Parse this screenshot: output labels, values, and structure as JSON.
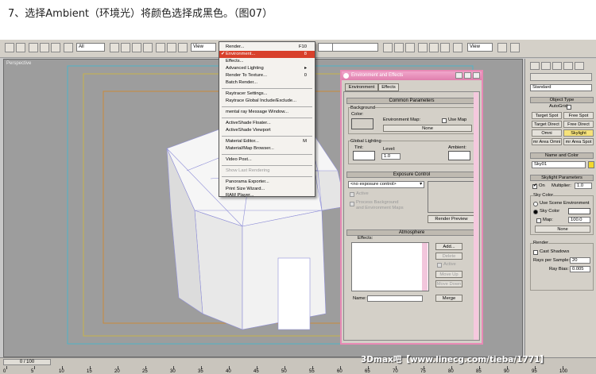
{
  "caption": "7、选择Ambient（环境光）将颜色选择成黑色。（图07）",
  "toolbar": {
    "select_filter": "All",
    "ref_coord": "View",
    "view_dropdown": "View"
  },
  "viewport": {
    "label": "Perspective"
  },
  "rendering_menu": {
    "items": [
      {
        "label": "Render...",
        "shortcut": "F10"
      },
      {
        "label": "Environment...",
        "shortcut": "8",
        "highlighted": true,
        "checked": true
      },
      {
        "label": "Effects...",
        "shortcut": ""
      },
      {
        "label": "Advanced Lighting",
        "shortcut": "",
        "submenu": true
      },
      {
        "label": "Render To Texture...",
        "shortcut": "0"
      },
      {
        "label": "Batch Render...",
        "shortcut": ""
      },
      {
        "label": "Raytracer Settings...",
        "shortcut": ""
      },
      {
        "label": "Raytrace Global Include/Exclude...",
        "shortcut": ""
      },
      {
        "label": "mental ray Message Window...",
        "shortcut": ""
      },
      {
        "label": "ActiveShade Floater...",
        "shortcut": ""
      },
      {
        "label": "ActiveShade Viewport",
        "shortcut": ""
      },
      {
        "label": "Material Editor...",
        "shortcut": "M"
      },
      {
        "label": "Material/Map Browser...",
        "shortcut": ""
      },
      {
        "label": "Video Post...",
        "shortcut": ""
      },
      {
        "label": "Show Last Rendering",
        "shortcut": "",
        "disabled": true
      },
      {
        "label": "Panorama Exporter...",
        "shortcut": ""
      },
      {
        "label": "Print Size Wizard...",
        "shortcut": ""
      },
      {
        "label": "RAM Player...",
        "shortcut": ""
      }
    ]
  },
  "env_dialog": {
    "title": "Environment and Effects",
    "tabs": [
      "Environment",
      "Effects"
    ],
    "common_params": {
      "header": "Common Parameters",
      "background_group": "Background",
      "color_label": "Color:",
      "env_map_label": "Environment Map:",
      "use_map_label": "Use Map",
      "map_button": "None",
      "background_color": "#000000"
    },
    "global_lighting": {
      "group": "Global Lighting",
      "tint_label": "Tint:",
      "level_label": "Level:",
      "level_value": "1.0",
      "ambient_label": "Ambient:"
    },
    "exposure": {
      "header": "Exposure Control",
      "dropdown": "<no exposure control>",
      "active_label": "Active",
      "process_label_1": "Process Background",
      "process_label_2": "and Environment Maps",
      "render_preview": "Render Preview"
    },
    "atmosphere": {
      "header": "Atmosphere",
      "effects_label": "Effects:",
      "add": "Add...",
      "delete": "Delete",
      "active": "Active",
      "move_up": "Move Up",
      "move_down": "Move Down",
      "name_label": "Name:",
      "merge": "Merge"
    }
  },
  "command_panel": {
    "category": "Standard",
    "object_type_header": "Object Type",
    "autogrid": "AutoGrid",
    "buttons": [
      "Target Spot",
      "Free Spot",
      "Target Direct",
      "Free Direct",
      "Omni",
      "Skylight",
      "mr Area Omni",
      "mr Area Spot"
    ],
    "name_color_header": "Name and Color",
    "object_name": "Sky01",
    "skylight_params_header": "Skylight Parameters",
    "on_label": "On",
    "multiplier_label": "Multiplier:",
    "multiplier_value": "1.0",
    "sky_color_label": "Sky Color",
    "use_scene_env": "Use Scene Environment",
    "sky_color_radio": "Sky Color",
    "map_label": "Map:",
    "map_value": "100.0",
    "map_button": "None",
    "render_label": "Render",
    "cast_shadows": "Cast Shadows",
    "rays_label": "Rays per Sample:",
    "rays_value": "20",
    "ray_bias_label": "Ray Bias:",
    "ray_bias_value": "0.005"
  },
  "timeline": {
    "frame_display": "0 / 100",
    "ticks": [
      "0",
      "5",
      "10",
      "15",
      "20",
      "25",
      "30",
      "35",
      "40",
      "45",
      "50",
      "55",
      "60",
      "65",
      "70",
      "75",
      "80",
      "85",
      "90",
      "95",
      "100"
    ]
  },
  "watermark": "3Dmax吧【www.linecg.com/tieba/1771】"
}
